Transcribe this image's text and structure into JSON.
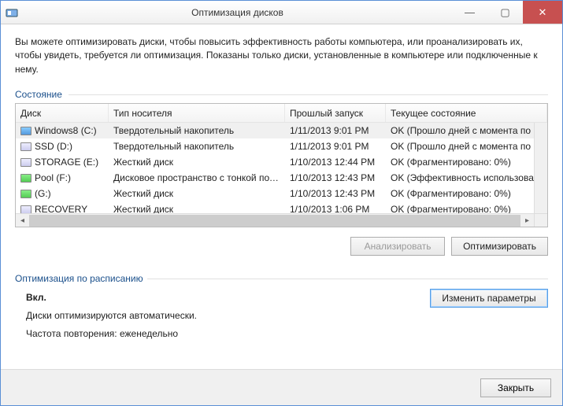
{
  "window": {
    "title": "Оптимизация дисков"
  },
  "description": "Вы можете оптимизировать диски, чтобы повысить эффективность работы  компьютера, или проанализировать их, чтобы увидеть, требуется ли оптимизация. Показаны только диски, установленные в компьютере или подключенные к нему.",
  "status_label": "Состояние",
  "columns": {
    "disk": "Диск",
    "media": "Тип носителя",
    "last": "Прошлый запуск",
    "status": "Текущее состояние"
  },
  "drives": [
    {
      "name": "Windows8 (C:)",
      "icon": "sys",
      "media": "Твердотельный накопитель",
      "last": "1/11/2013 9:01 PM",
      "status": "OK (Прошло дней с момента по",
      "selected": true
    },
    {
      "name": "SSD (D:)",
      "icon": "",
      "media": "Твердотельный накопитель",
      "last": "1/11/2013 9:01 PM",
      "status": "OK (Прошло дней с момента по"
    },
    {
      "name": "STORAGE (E:)",
      "icon": "",
      "media": "Жесткий диск",
      "last": "1/10/2013 12:44 PM",
      "status": "OK (Фрагментировано: 0%)"
    },
    {
      "name": "Pool (F:)",
      "icon": "pool",
      "media": "Дисковое пространство с тонкой подг...",
      "last": "1/10/2013 12:43 PM",
      "status": "OK (Эффективность использова"
    },
    {
      "name": "(G:)",
      "icon": "pool",
      "media": "Жесткий диск",
      "last": "1/10/2013 12:43 PM",
      "status": "OK (Фрагментировано: 0%)"
    },
    {
      "name": "RECOVERY",
      "icon": "",
      "media": "Жесткий диск",
      "last": "1/10/2013 1:06 PM",
      "status": "OK (Фрагментировано: 0%)"
    }
  ],
  "buttons": {
    "analyze": "Анализировать",
    "optimize": "Оптимизировать",
    "change": "Изменить параметры",
    "close": "Закрыть"
  },
  "schedule": {
    "heading": "Оптимизация по расписанию",
    "on": "Вкл.",
    "auto": "Диски оптимизируются автоматически.",
    "freq": "Частота повторения: еженедельно"
  }
}
